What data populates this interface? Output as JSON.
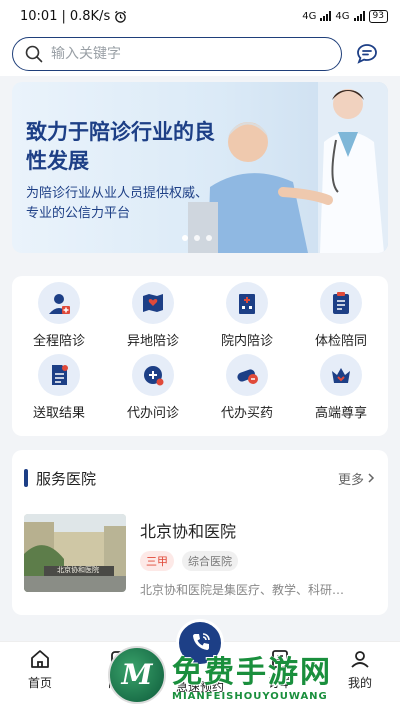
{
  "status": {
    "time": "10:01",
    "speed": "0.8K/s",
    "network1": "4G",
    "network2": "4G",
    "battery": "93"
  },
  "search": {
    "placeholder": "输入关键字"
  },
  "banner": {
    "title": "致力于陪诊行业的良性发展",
    "subtitle": "为陪诊行业从业人员提供权威、专业的公信力平台"
  },
  "services": [
    {
      "label": "全程陪诊",
      "icon": "nurse-icon"
    },
    {
      "label": "异地陪诊",
      "icon": "map-heart-icon"
    },
    {
      "label": "院内陪诊",
      "icon": "hospital-building-icon"
    },
    {
      "label": "体检陪同",
      "icon": "clipboard-icon"
    },
    {
      "label": "送取结果",
      "icon": "document-icon"
    },
    {
      "label": "代办问诊",
      "icon": "consult-chat-icon"
    },
    {
      "label": "代办买药",
      "icon": "pill-icon"
    },
    {
      "label": "高端尊享",
      "icon": "crown-icon"
    }
  ],
  "hospital_section": {
    "title": "服务医院",
    "more": "更多",
    "items": [
      {
        "name": "北京协和医院",
        "tags": [
          "三甲",
          "综合医院"
        ],
        "description": "北京协和医院是集医疗、教学、科研…",
        "photo_sign": "北京协和医院"
      }
    ]
  },
  "tabbar": {
    "home": "首页",
    "consult": "问诊",
    "center": "急速预约",
    "orders": "订单",
    "mine": "我的"
  },
  "watermark": {
    "logo_letter": "M",
    "main": "免费手游网",
    "sub": "MIANFEISHOUYOUWANG"
  },
  "colors": {
    "brand": "#1d3f86",
    "accent_red": "#e04a3a",
    "watermark": "#1a8f3d"
  }
}
